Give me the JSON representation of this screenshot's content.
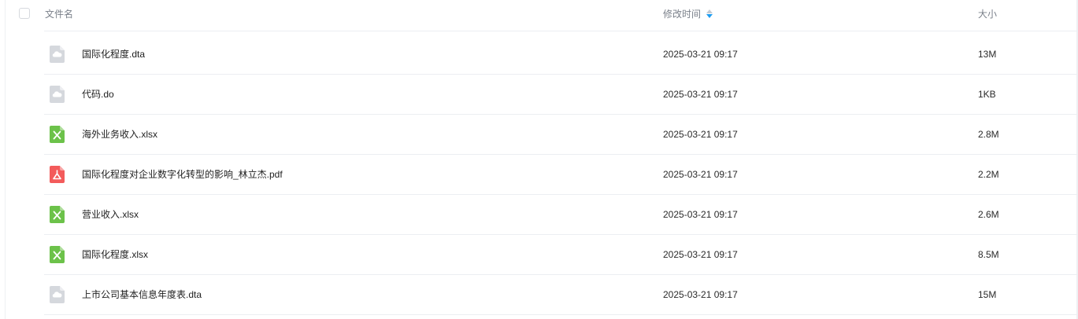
{
  "header": {
    "name_label": "文件名",
    "time_label": "修改时间",
    "size_label": "大小",
    "sort_icon": "sort-descending-icon"
  },
  "colors": {
    "generic_file": "#d5d8dd",
    "excel": "#6cc24a",
    "pdf": "#f35b5b",
    "sort_active": "#1e9cf0"
  },
  "files": [
    {
      "name": "国际化程度.dta",
      "time": "2025-03-21 09:17",
      "size": "13M",
      "type": "generic"
    },
    {
      "name": "代码.do",
      "time": "2025-03-21 09:17",
      "size": "1KB",
      "type": "generic"
    },
    {
      "name": "海外业务收入.xlsx",
      "time": "2025-03-21 09:17",
      "size": "2.8M",
      "type": "excel"
    },
    {
      "name": "国际化程度对企业数字化转型的影响_林立杰.pdf",
      "time": "2025-03-21 09:17",
      "size": "2.2M",
      "type": "pdf"
    },
    {
      "name": "营业收入.xlsx",
      "time": "2025-03-21 09:17",
      "size": "2.6M",
      "type": "excel"
    },
    {
      "name": "国际化程度.xlsx",
      "time": "2025-03-21 09:17",
      "size": "8.5M",
      "type": "excel"
    },
    {
      "name": "上市公司基本信息年度表.dta",
      "time": "2025-03-21 09:17",
      "size": "15M",
      "type": "generic"
    }
  ]
}
